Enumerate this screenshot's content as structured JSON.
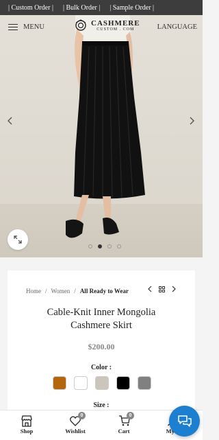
{
  "topbar": {
    "links": [
      "| Custom Order |",
      "| Bulk Order |",
      "| Sample Order |"
    ]
  },
  "header": {
    "menu_label": "MENU",
    "logo_line1": "CASHMERE",
    "logo_line2": "CUSTOM . COM",
    "language_label": "LANGUAGE"
  },
  "gallery": {
    "slide_count": 4,
    "active_slide": 2
  },
  "breadcrumb": {
    "home": "Home",
    "sep": "/",
    "category": "Women",
    "current": "All Ready to Wear"
  },
  "product": {
    "title_line1": "Cable-Knit Inner Mongolia",
    "title_line2": "Cashmere Skirt",
    "price": "$200.00",
    "color_label": "Color :",
    "colors": [
      "#b5650b",
      "#ffffff",
      "#cbc5bb",
      "#000000",
      "#808080"
    ],
    "size_label": "Size :"
  },
  "bottom_nav": {
    "shop": "Shop",
    "wishlist": "Wishlist",
    "wishlist_count": "0",
    "cart": "Cart",
    "cart_count": "0",
    "account": "My a"
  }
}
